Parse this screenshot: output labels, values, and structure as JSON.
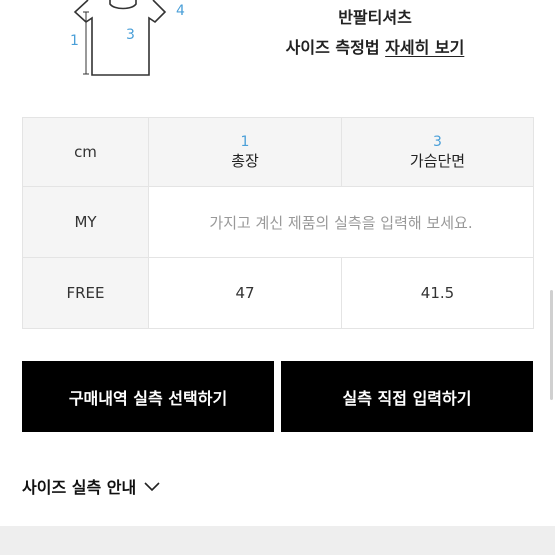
{
  "diagram": {
    "labels": [
      "1",
      "3",
      "4"
    ]
  },
  "header": {
    "product_type": "반팔티셔츠",
    "guide_prefix": "사이즈 측정법",
    "guide_link": "자세히 보기"
  },
  "table": {
    "unit": "cm",
    "columns": [
      {
        "number": "1",
        "name": "총장"
      },
      {
        "number": "3",
        "name": "가슴단면"
      }
    ],
    "my_row": {
      "label": "MY",
      "placeholder": "가지고 계신 제품의 실측을 입력해 보세요."
    },
    "rows": [
      {
        "label": "FREE",
        "values": [
          "47",
          "41.5"
        ]
      }
    ]
  },
  "buttons": {
    "select_history": "구매내역 실측 선택하기",
    "direct_input": "실측 직접 입력하기"
  },
  "size_guide": {
    "label": "사이즈 실측 안내",
    "icon": "chevron-down-icon"
  },
  "colors": {
    "accent_number": "#4a9fd8",
    "button_bg": "#000000",
    "header_bg": "#f5f5f5"
  }
}
